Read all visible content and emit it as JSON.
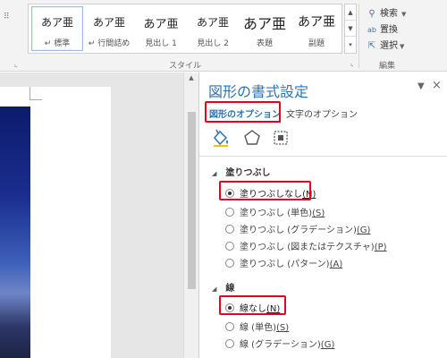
{
  "ribbon": {
    "styles": [
      {
        "preview": "あア亜",
        "name": "↵ 標準",
        "selected": true
      },
      {
        "preview": "あア亜",
        "name": "↵ 行間詰め",
        "selected": false
      },
      {
        "preview": "あア亜",
        "name": "見出し 1",
        "selected": false
      },
      {
        "preview": "あア亜",
        "name": "見出し 2",
        "selected": false
      },
      {
        "preview": "あア亜",
        "name": "表題",
        "selected": false
      },
      {
        "preview": "あア亜",
        "name": "副題",
        "selected": false
      }
    ],
    "styles_group_label": "スタイル",
    "editing_group_label": "編集",
    "editing": {
      "find_label": "検索",
      "replace_label": "置換",
      "select_label": "選択"
    }
  },
  "pane": {
    "title": "図形の書式設定",
    "tabs": [
      {
        "label": "図形のオプション",
        "active": true
      },
      {
        "label": "文字のオプション",
        "active": false
      }
    ],
    "icons": [
      "fill-line-icon",
      "effects-pentagon-icon",
      "size-properties-icon"
    ],
    "fill_section": {
      "title": "塗りつぶし",
      "options": [
        {
          "label": "塗りつぶしなし",
          "key": "(N)",
          "selected": true
        },
        {
          "label": "塗りつぶし (単色)",
          "key": "(S)",
          "selected": false
        },
        {
          "label": "塗りつぶし (グラデーション)",
          "key": "(G)",
          "selected": false
        },
        {
          "label": "塗りつぶし (図またはテクスチャ)",
          "key": "(P)",
          "selected": false
        },
        {
          "label": "塗りつぶし (パターン)",
          "key": "(A)",
          "selected": false
        }
      ]
    },
    "line_section": {
      "title": "線",
      "options": [
        {
          "label": "線なし",
          "key": "(N)",
          "selected": true
        },
        {
          "label": "線 (単色)",
          "key": "(S)",
          "selected": false
        },
        {
          "label": "線 (グラデーション)",
          "key": "(G)",
          "selected": false
        }
      ]
    }
  },
  "colors": {
    "accent": "#2e74b5",
    "highlight": "#e8001c"
  }
}
